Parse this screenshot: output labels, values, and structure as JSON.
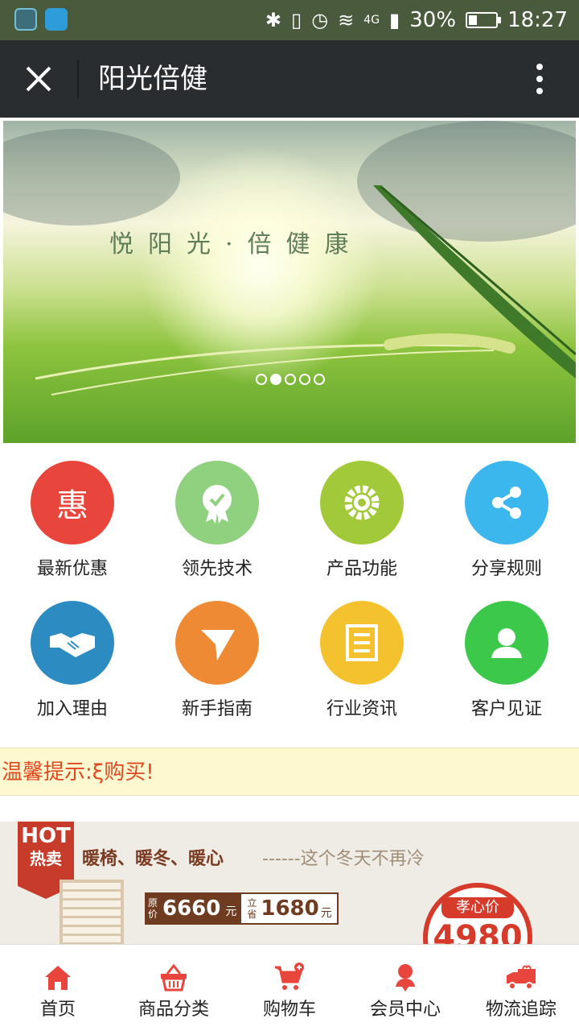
{
  "status_bar": {
    "battery": "30%",
    "battery_level": 0.3,
    "time": "18:27",
    "network": "4G",
    "icons": [
      "bluetooth-icon",
      "vibrate-icon",
      "alarm-icon",
      "wifi-icon",
      "signal-icon"
    ]
  },
  "title_bar": {
    "title": "阳光倍健"
  },
  "banner": {
    "slogan": "悦阳光·倍健康",
    "slide_count": 5,
    "active_slide": 2
  },
  "menu": [
    {
      "label": "最新优惠",
      "icon": "hui-icon",
      "color": "#e8453c"
    },
    {
      "label": "领先技术",
      "icon": "award-icon",
      "color": "#8fd17e"
    },
    {
      "label": "产品功能",
      "icon": "gear-icon",
      "color": "#a2c93a"
    },
    {
      "label": "分享规则",
      "icon": "share-icon",
      "color": "#3cb7ee"
    },
    {
      "label": "加入理由",
      "icon": "handshake-icon",
      "color": "#2c8bc0"
    },
    {
      "label": "新手指南",
      "icon": "navigation-icon",
      "color": "#ee8a34"
    },
    {
      "label": "行业资讯",
      "icon": "news-icon",
      "color": "#f5c22f"
    },
    {
      "label": "客户见证",
      "icon": "user-icon",
      "color": "#3cc84a"
    }
  ],
  "notice": {
    "label": "温馨提示:",
    "text": "ξ购买!"
  },
  "promo": {
    "badge_top": "HOT",
    "badge_bottom": "热卖",
    "headline": "暖椅、暖冬、暖心",
    "subline": "------这个冬天不再冷",
    "original_label": "原价",
    "original_price": "6660",
    "original_unit": "元",
    "current_label": "立省",
    "current_price": "1680",
    "current_unit": "元",
    "stamp_label": "孝心价",
    "stamp_price": "4980"
  },
  "bottom_nav": [
    {
      "label": "首页",
      "icon": "home-icon"
    },
    {
      "label": "商品分类",
      "icon": "basket-icon"
    },
    {
      "label": "购物车",
      "icon": "cart-icon"
    },
    {
      "label": "会员中心",
      "icon": "member-icon"
    },
    {
      "label": "物流追踪",
      "icon": "truck-icon"
    }
  ],
  "colors": {
    "accent_red": "#e8453c",
    "title_bar": "#2a2d30",
    "status_bar": "#4a5a3c"
  }
}
